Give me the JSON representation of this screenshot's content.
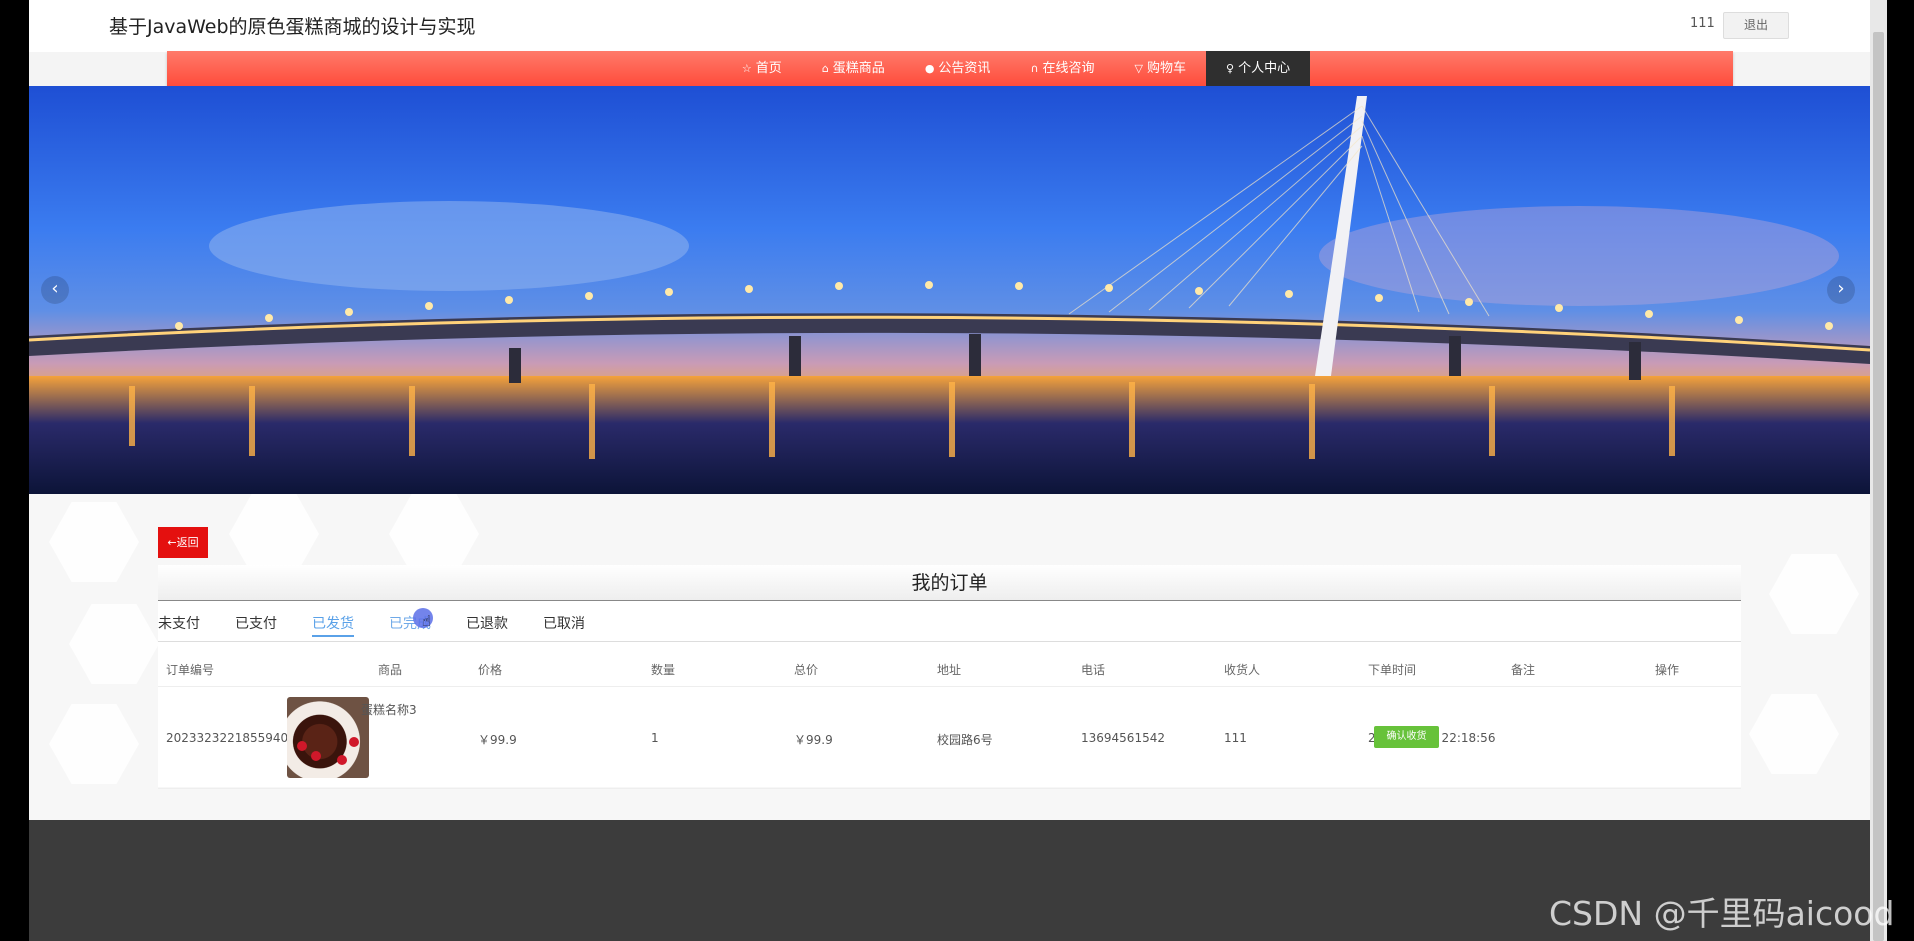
{
  "header": {
    "site_title": "基于JavaWeb的原色蛋糕商城的设计与实现",
    "user_name": "111",
    "logout_label": "退出"
  },
  "nav": {
    "items": [
      {
        "icon": "star-icon",
        "label": "首页"
      },
      {
        "icon": "bag-icon",
        "label": "蛋糕商品"
      },
      {
        "icon": "info-icon",
        "label": "公告资讯"
      },
      {
        "icon": "headset-icon",
        "label": "在线咨询"
      },
      {
        "icon": "cart-icon",
        "label": "购物车"
      },
      {
        "icon": "user-icon",
        "label": "个人中心",
        "active": true
      }
    ]
  },
  "banner": {
    "prev_glyph": "‹",
    "next_glyph": "›"
  },
  "content": {
    "back_label": "←返回",
    "panel_title": "我的订单",
    "tabs": [
      {
        "label": "未支付"
      },
      {
        "label": "已支付"
      },
      {
        "label": "已发货",
        "active": true
      },
      {
        "label": "已完成"
      },
      {
        "label": "已退款"
      },
      {
        "label": "已取消"
      }
    ],
    "columns": [
      "订单编号",
      "商品",
      "价格",
      "数量",
      "总价",
      "地址",
      "电话",
      "收货人",
      "下单时间",
      "备注",
      "操作"
    ],
    "orders": [
      {
        "order_no": "2023323221855940",
        "product_name": "蛋糕名称3",
        "price": "￥99.9",
        "quantity": "1",
        "total": "￥99.9",
        "address": "校园路6号",
        "phone": "13694561542",
        "receiver": "111",
        "order_time": "2023-03-23 22:18:56",
        "remark": "",
        "action_label": "确认收货"
      }
    ]
  },
  "watermark": "CSDN @千里码aicood",
  "colors": {
    "nav_bg": "#ff5a48",
    "nav_active": "#2f2f2f",
    "back_button": "#e4100f",
    "tab_active": "#5aa1e8",
    "confirm_button": "#67c23a",
    "footer": "#3c3c3c"
  }
}
